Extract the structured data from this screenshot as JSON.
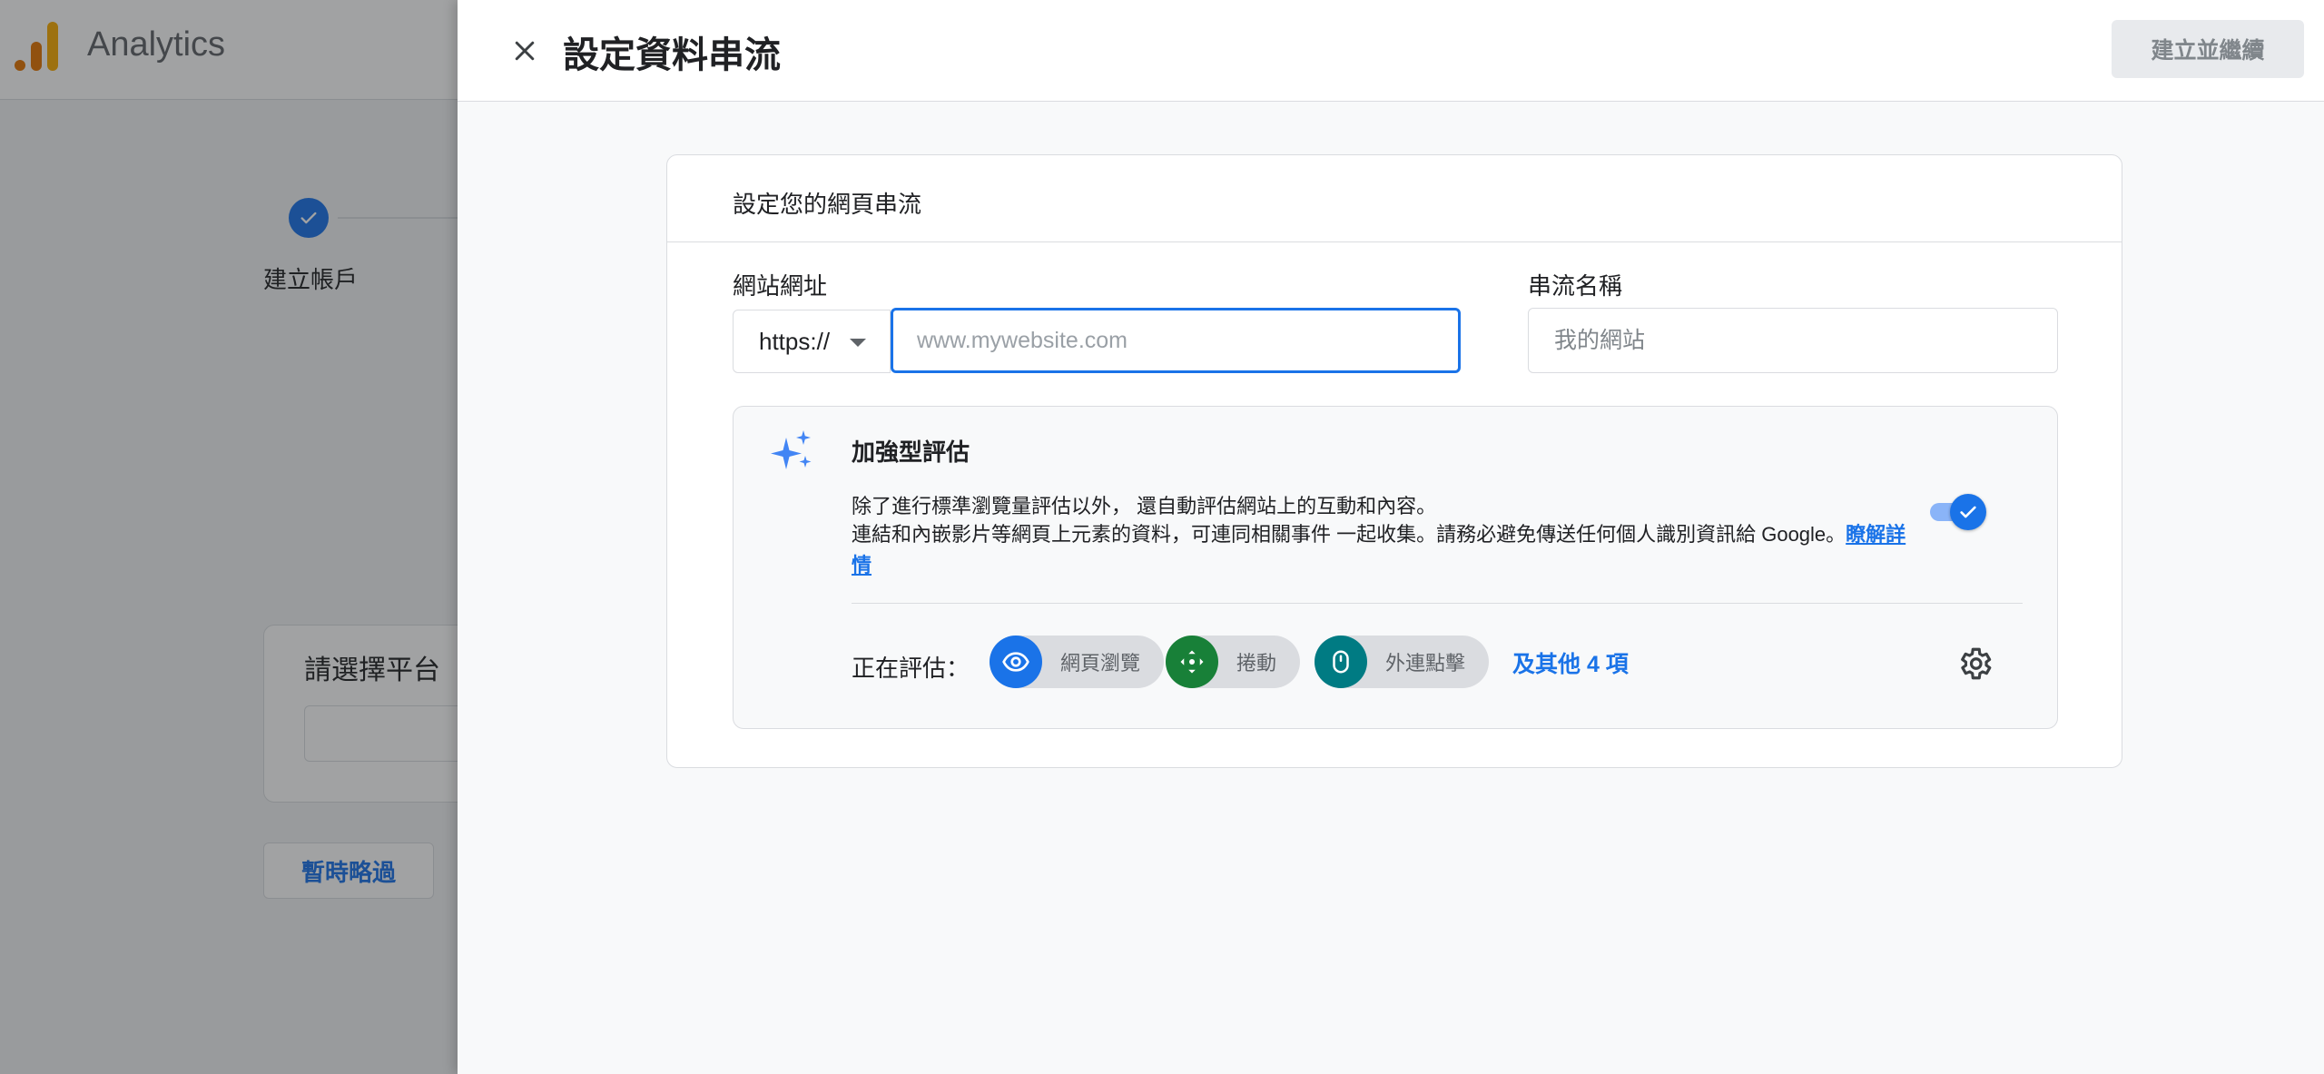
{
  "app": {
    "title": "Analytics"
  },
  "background": {
    "stepper_label": "建立帳戶",
    "platform_title": "請選擇平台",
    "skip_label": "暫時略過"
  },
  "panel": {
    "title": "設定資料串流",
    "primary_button": "建立並繼續"
  },
  "card": {
    "title": "設定您的網頁串流",
    "website_url_label": "網站網址",
    "protocol_value": "https://",
    "url_placeholder": "www.mywebsite.com",
    "stream_name_label": "串流名稱",
    "stream_name_placeholder": "我的網站"
  },
  "enhanced": {
    "title": "加強型評估",
    "desc_line1": "除了進行標準瀏覽量評估以外， 還自動評估網站上的互動和內容。",
    "desc_line2": "連結和內嵌影片等網頁上元素的資料，可連同相關事件 一起收集。請務必避免傳送任何個人識別資訊給 Google。",
    "learn_more": "瞭解詳情",
    "toggle_on": true,
    "measuring_label": "正在評估：",
    "chips": [
      {
        "label": "網頁瀏覽",
        "icon": "eye-icon",
        "color": "#1a73e8"
      },
      {
        "label": "捲動",
        "icon": "scroll-icon",
        "color": "#188038"
      },
      {
        "label": "外連點擊",
        "icon": "mouse-icon",
        "color": "#007b83"
      }
    ],
    "more_link": "及其他 4 項"
  },
  "colors": {
    "accent": "#1a73e8",
    "disabled_bg": "#e8eaed",
    "border": "#dadce0"
  }
}
